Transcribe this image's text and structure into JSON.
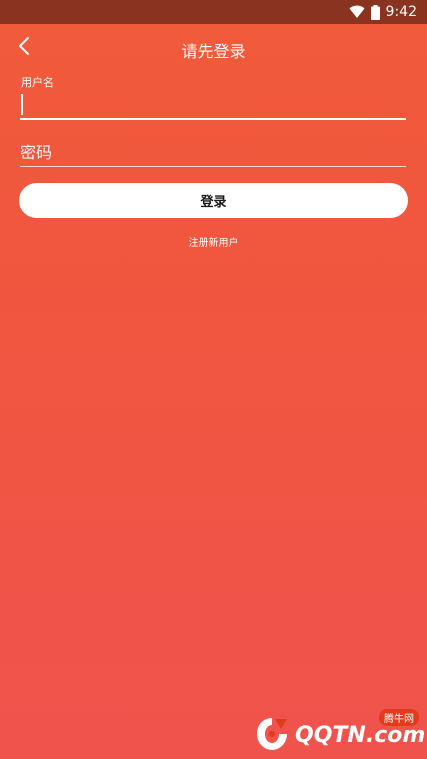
{
  "status_bar": {
    "time": "9:42",
    "icons": [
      "wifi-icon",
      "battery-icon"
    ]
  },
  "app_bar": {
    "back_icon": "chevron-left-icon",
    "title": "请先登录"
  },
  "username": {
    "label": "用户名",
    "value": ""
  },
  "password": {
    "placeholder": "密码",
    "value": ""
  },
  "login_button": {
    "label": "登录"
  },
  "register_link": {
    "label": "注册新用户"
  },
  "watermark": {
    "badge": "腾牛网",
    "text": "QQTN.com"
  },
  "colors": {
    "status_bar": "#8a3320",
    "background_top": "#f15a3a",
    "background_bottom": "#f0534c",
    "button_bg": "#ffffff",
    "button_text": "#1a1a1a"
  }
}
